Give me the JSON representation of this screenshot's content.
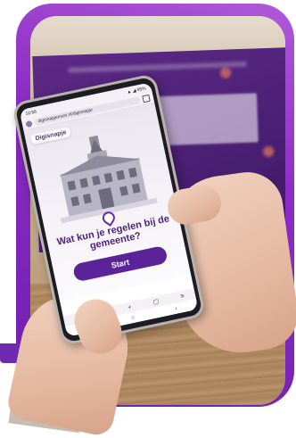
{
  "phone_screen": {
    "status_bar": {
      "time": "10:56",
      "right": "▲ ◢ 95%"
    },
    "url": "digisnapjemuni.nl/digisnapje",
    "brand": "Digisnapje",
    "headline": "Wat kun je regelen bij de gemeente?",
    "start_label": "Start",
    "toolbar_icons": [
      "home-icon",
      "share-icon",
      "plus-icon",
      "tabs-icon",
      "menu-icon"
    ],
    "nav_icons": [
      "recent-icon",
      "home-circle-icon",
      "back-icon"
    ]
  },
  "colors": {
    "frame_purple": "#8a2bc4",
    "brand_purple": "#5b2399",
    "booklet_purple": "#4a1f73"
  }
}
